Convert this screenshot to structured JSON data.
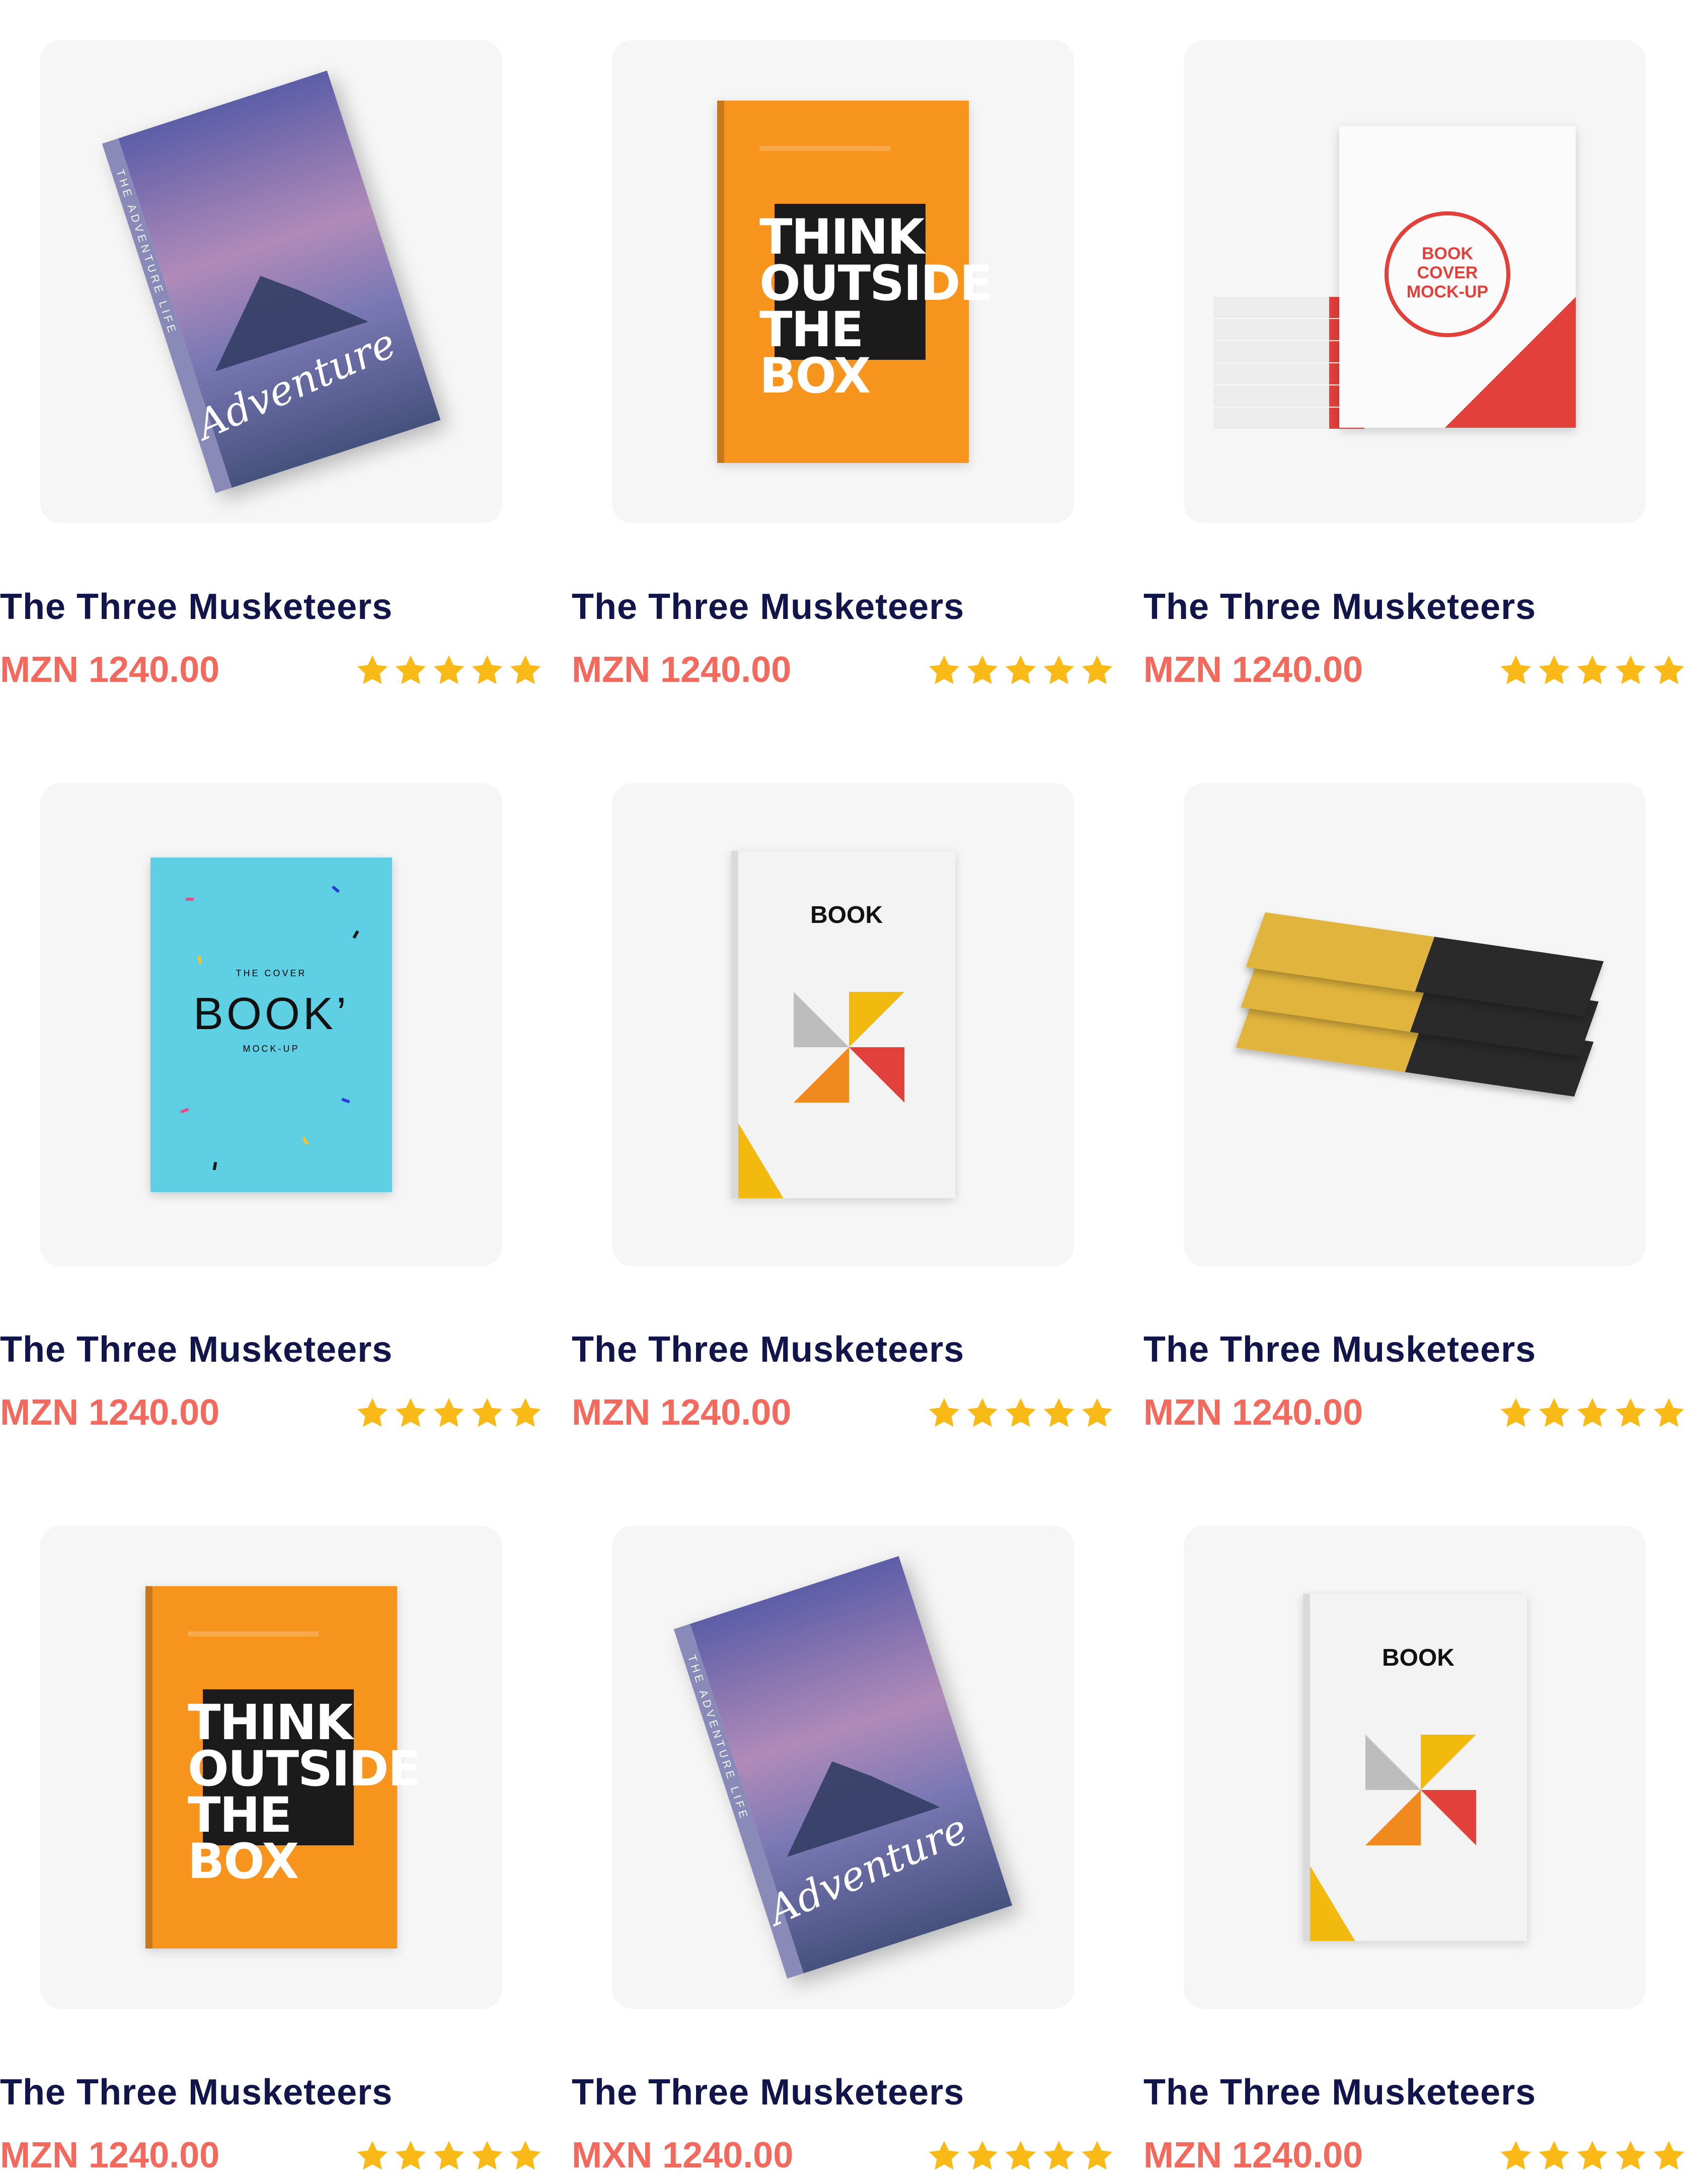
{
  "products": [
    {
      "title": "The Three Musketeers",
      "price": "MZN 1240.00",
      "rating": 5,
      "cover": "adventure",
      "cover_text": {
        "script": "Adventure",
        "spine": "THE ADVENTURE LIFE"
      }
    },
    {
      "title": "The Three Musketeers",
      "price": "MZN 1240.00",
      "rating": 5,
      "cover": "think",
      "cover_text": {
        "headline": "THINK OUTSIDE THE BOX"
      }
    },
    {
      "title": "The Three Musketeers",
      "price": "MZN 1240.00",
      "rating": 5,
      "cover": "cover-stack",
      "cover_text": {
        "headline": "BOOK COVER MOCK-UP"
      }
    },
    {
      "title": "The Three Musketeers",
      "price": "MZN 1240.00",
      "rating": 5,
      "cover": "bookcover",
      "cover_text": {
        "top": "THE COVER",
        "headline": "BOOK’",
        "sub": "MOCK-UP"
      }
    },
    {
      "title": "The Three Musketeers",
      "price": "MZN 1240.00",
      "rating": 5,
      "cover": "bookmock",
      "cover_text": {
        "headline": "BOOK"
      }
    },
    {
      "title": "The Three Musketeers",
      "price": "MZN 1240.00",
      "rating": 5,
      "cover": "piles",
      "cover_text": {}
    },
    {
      "title": "The Three Musketeers",
      "price": "MZN 1240.00",
      "rating": 5,
      "cover": "think",
      "cover_text": {
        "headline": "THINK OUTSIDE THE BOX"
      }
    },
    {
      "title": "The Three Musketeers",
      "price": "MXN 1240.00",
      "rating": 5,
      "cover": "adventure",
      "cover_text": {
        "script": "Adventure",
        "spine": "THE ADVENTURE LIFE"
      }
    },
    {
      "title": "The Three Musketeers",
      "price": "MZN 1240.00",
      "rating": 5,
      "cover": "bookmock",
      "cover_text": {
        "headline": "BOOK"
      }
    }
  ],
  "colors": {
    "title": "#11154a",
    "price": "#f26a5d",
    "star": "#f9b916",
    "card_bg": "#f6f6f6"
  },
  "icons": {
    "rating": "star-icon"
  }
}
